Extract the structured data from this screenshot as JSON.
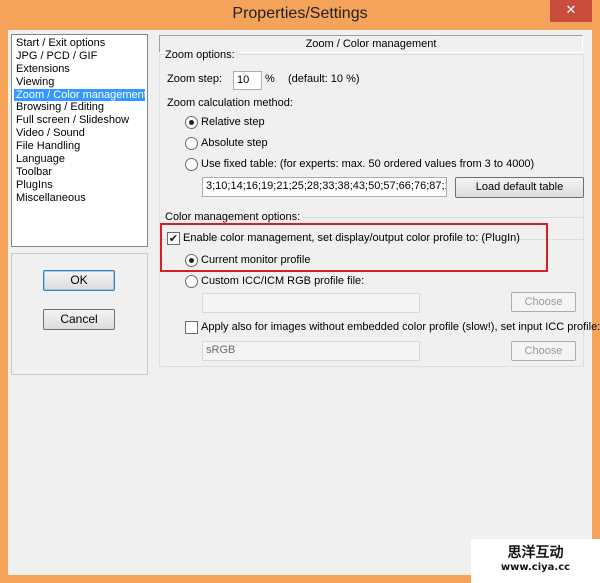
{
  "window": {
    "title": "Properties/Settings",
    "close_label": "✕"
  },
  "sidebar": {
    "items": [
      {
        "label": "Start / Exit options"
      },
      {
        "label": "JPG / PCD / GIF"
      },
      {
        "label": "Extensions"
      },
      {
        "label": "Viewing"
      },
      {
        "label": "Zoom / Color management"
      },
      {
        "label": "Browsing / Editing"
      },
      {
        "label": "Full screen / Slideshow"
      },
      {
        "label": "Video / Sound"
      },
      {
        "label": "File Handling"
      },
      {
        "label": "Language"
      },
      {
        "label": "Toolbar"
      },
      {
        "label": "PlugIns"
      },
      {
        "label": "Miscellaneous"
      }
    ],
    "selected": "Zoom / Color management"
  },
  "buttons": {
    "ok": "OK",
    "cancel": "Cancel"
  },
  "page": {
    "header": "Zoom / Color management"
  },
  "zoom": {
    "group_label": "Zoom options:",
    "step_label": "Zoom step:",
    "step_value": "10",
    "step_unit": "%",
    "step_default": "(default: 10 %)",
    "method_label": "Zoom calculation method:",
    "relative_label": "Relative step",
    "absolute_label": "Absolute step",
    "fixed_label": "Use fixed table: (for experts: max. 50 ordered values from 3 to 4000)",
    "table_value": "3;10;14;16;19;21;25;28;33;38;43;50;57;66;76;87;1",
    "load_default": "Load default table",
    "selected_method": "Relative step"
  },
  "color": {
    "group_label": "Color management options:",
    "enable_label": "Enable color management, set display/output color profile to: (PlugIn)",
    "enable_checked": true,
    "current_monitor_label": "Current monitor profile",
    "custom_label": "Custom ICC/ICM RGB profile file:",
    "custom_file_value": "",
    "choose_label": "Choose",
    "apply_also_label": "Apply also for images without embedded color profile (slow!), set input ICC profile:",
    "apply_also_checked": false,
    "input_profile_value": "sRGB",
    "choose2_label": "Choose",
    "selected_profile": "Current monitor profile",
    "highlight_color": "#d61f26"
  },
  "watermark": {
    "title": "思洋互动",
    "url": "www.ciya.cc"
  }
}
